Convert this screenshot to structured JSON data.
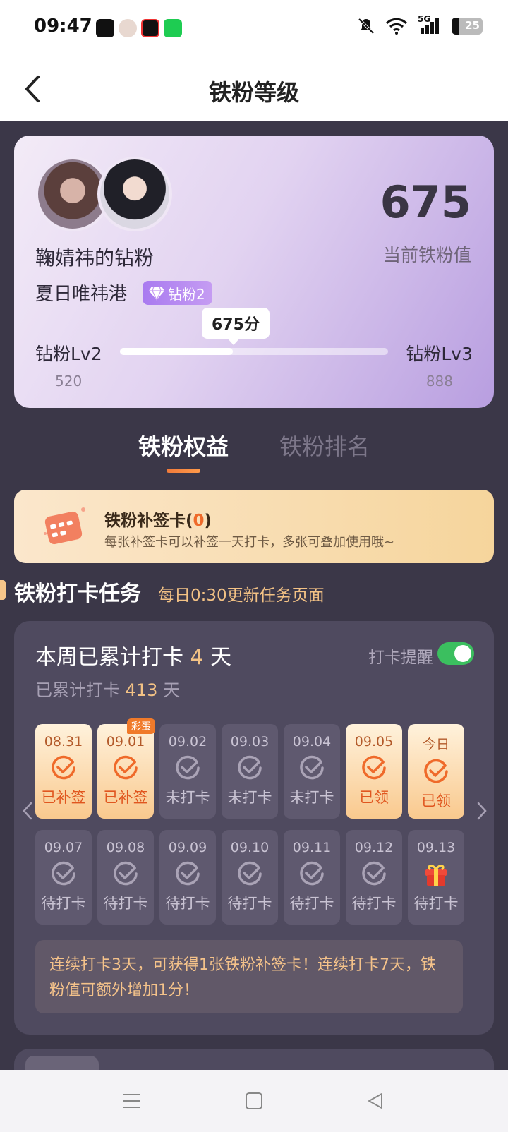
{
  "status_bar": {
    "time": "09:47",
    "network": "5G",
    "battery": "25",
    "app_icons": [
      "tiktok-app-icon",
      "avatar-app-icon",
      "video-app-icon",
      "wechat-app-icon"
    ]
  },
  "header": {
    "title": "铁粉等级",
    "back_icon": "chevron-left-icon"
  },
  "profile": {
    "fan_name": "鞠婧祎的钻粉",
    "group_name": "夏日唯祎港",
    "level_badge": "钻粉2",
    "fan_value": "675",
    "fan_value_label": "当前铁粉值",
    "score_bubble": "675分",
    "current_level": "钻粉Lv2",
    "next_level": "钻粉Lv3",
    "current_level_points": "520",
    "next_level_points": "888",
    "progress_fraction": 0.42
  },
  "tabs": [
    {
      "label": "铁粉权益",
      "active": true
    },
    {
      "label": "铁粉排名",
      "active": false
    }
  ],
  "makeup_card": {
    "title": "铁粉补签卡",
    "count_open": "(",
    "count": "0",
    "count_close": ")",
    "description": "每张补签卡可以补签一天打卡，多张可叠加使用哦~"
  },
  "section": {
    "title": "铁粉打卡任务",
    "subtitle": "每日0:30更新任务页面"
  },
  "checkin": {
    "week_prefix": "本周已累计打卡 ",
    "week_days": "4",
    "week_suffix": " 天",
    "total_prefix": "已累计打卡 ",
    "total_days": "413",
    "total_suffix": " 天",
    "reminder_label": "打卡提醒",
    "reminder_on": true,
    "egg_tag": "彩蛋",
    "row1": [
      {
        "date": "08.31",
        "status": "已补签",
        "done": true
      },
      {
        "date": "09.01",
        "status": "已补签",
        "done": true
      },
      {
        "date": "09.02",
        "status": "未打卡",
        "done": false
      },
      {
        "date": "09.03",
        "status": "未打卡",
        "done": false
      },
      {
        "date": "09.04",
        "status": "未打卡",
        "done": false
      },
      {
        "date": "09.05",
        "status": "已领",
        "done": true
      },
      {
        "date": "今日",
        "status": "已领",
        "done": true
      }
    ],
    "row2": [
      {
        "date": "09.07",
        "status": "待打卡"
      },
      {
        "date": "09.08",
        "status": "待打卡"
      },
      {
        "date": "09.09",
        "status": "待打卡"
      },
      {
        "date": "09.10",
        "status": "待打卡"
      },
      {
        "date": "09.11",
        "status": "待打卡"
      },
      {
        "date": "09.12",
        "status": "待打卡"
      },
      {
        "date": "09.13",
        "status": "待打卡",
        "gift": true
      }
    ],
    "tip": "连续打卡3天，可获得1张铁粉补签卡！连续打卡7天，铁粉值可额外增加1分！"
  },
  "colors": {
    "background": "#3b3748",
    "accent_orange": "#ef6a2a",
    "highlight_gold": "#f3c285",
    "toggle_green": "#3bbf5f"
  }
}
